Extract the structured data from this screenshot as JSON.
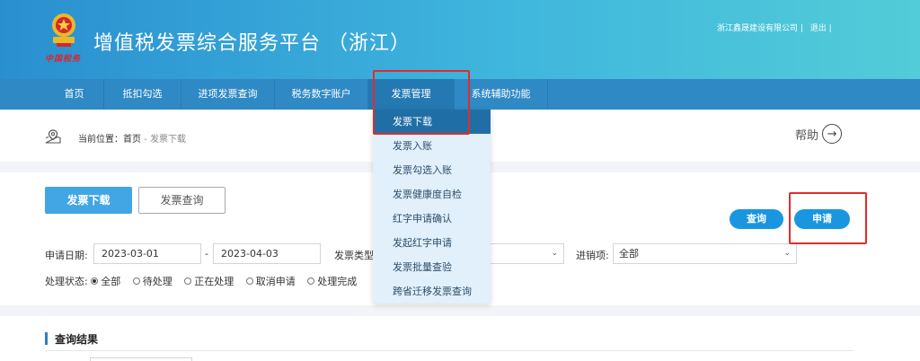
{
  "header": {
    "title": "增值税发票综合服务平台 （浙江）",
    "emblem_caption": "中国税务",
    "company": "浙江鑫晟建设有限公司 |",
    "logout": "退出 |"
  },
  "nav": {
    "items": [
      {
        "label": "首页"
      },
      {
        "label": "抵扣勾选"
      },
      {
        "label": "进项发票查询"
      },
      {
        "label": "税务数字账户"
      },
      {
        "label": "发票管理"
      },
      {
        "label": "系统辅助功能"
      }
    ]
  },
  "dropdown": {
    "items": [
      {
        "label": "发票下载"
      },
      {
        "label": "发票入账"
      },
      {
        "label": "发票勾选入账"
      },
      {
        "label": "发票健康度自检"
      },
      {
        "label": "红字申请确认"
      },
      {
        "label": "发起红字申请"
      },
      {
        "label": "发票批量查验"
      },
      {
        "label": "跨省迁移发票查询"
      }
    ],
    "selected": "发票下载"
  },
  "breadcrumb": {
    "prefix": "当前位置：",
    "home": "首页",
    "separator": " - ",
    "current": "发票下载",
    "help": "帮助"
  },
  "tabs": {
    "download": "发票下载",
    "query": "发票查询"
  },
  "actions": {
    "search": "查询",
    "apply": "申请"
  },
  "form": {
    "apply_date_label": "申请日期:",
    "date_from": "2023-03-01",
    "date_sep": "-",
    "date_to": "2023-04-03",
    "invoice_type_label": "发票类型",
    "direction_label": "进销项:",
    "direction_value": "全部",
    "status_label": "处理状态:",
    "status_options": [
      {
        "label": "全部",
        "checked": true
      },
      {
        "label": "待处理",
        "checked": false
      },
      {
        "label": "正在处理",
        "checked": false
      },
      {
        "label": "取消申请",
        "checked": false
      },
      {
        "label": "处理完成",
        "checked": false
      }
    ]
  },
  "results": {
    "title": "查询结果"
  },
  "colors": {
    "header_start": "#2a8fd0",
    "header_end": "#52ccd8",
    "nav": "#2f89c4",
    "primary": "#41a6e3",
    "pill": "#1a96e0",
    "highlight": "#e32b2b",
    "dropdown_bg": "#e1f0fa",
    "dropdown_selected": "#1f6fa6"
  }
}
